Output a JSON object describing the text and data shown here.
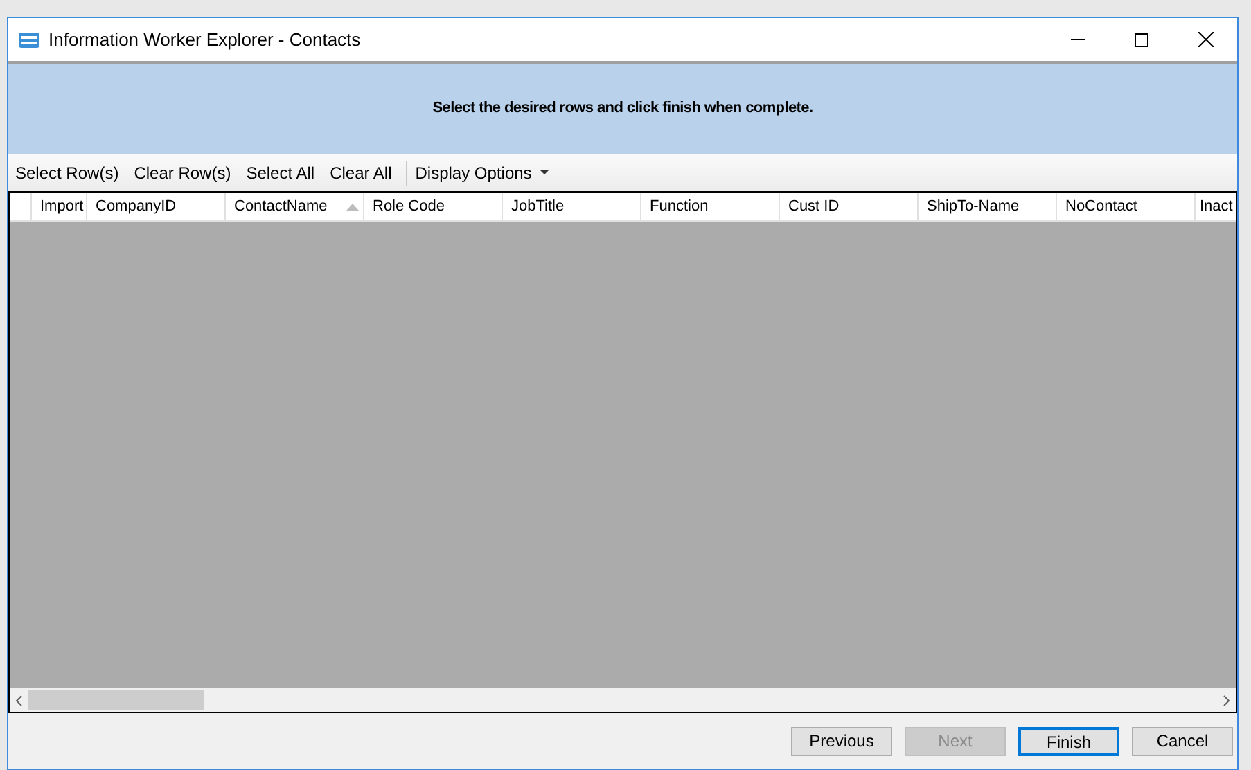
{
  "window": {
    "title": "Information Worker Explorer - Contacts"
  },
  "banner": {
    "text": "Select the desired rows and click finish when complete."
  },
  "toolbar": [
    {
      "label": "Select Row(s)",
      "kind": "button"
    },
    {
      "label": "Clear Row(s)",
      "kind": "button"
    },
    {
      "label": "Select All",
      "kind": "button"
    },
    {
      "label": "Clear All",
      "kind": "button"
    },
    {
      "label": "Display Options",
      "kind": "dropdown"
    }
  ],
  "table": {
    "columns": [
      {
        "label": "Import",
        "sorted": false
      },
      {
        "label": "CompanyID",
        "sorted": false
      },
      {
        "label": "ContactName",
        "sorted": true
      },
      {
        "label": "Role Code",
        "sorted": false
      },
      {
        "label": "JobTitle",
        "sorted": false
      },
      {
        "label": "Function",
        "sorted": false
      },
      {
        "label": "Cust ID",
        "sorted": false
      },
      {
        "label": "ShipTo-Name",
        "sorted": false
      },
      {
        "label": "NoContact",
        "sorted": false
      },
      {
        "label": "Inact",
        "sorted": false
      }
    ]
  },
  "buttons": [
    {
      "label": "Previous",
      "disabled": false,
      "default": false
    },
    {
      "label": "Next",
      "disabled": true,
      "default": false
    },
    {
      "label": "Finish",
      "disabled": false,
      "default": true
    },
    {
      "label": "Cancel",
      "disabled": false,
      "default": false
    }
  ]
}
